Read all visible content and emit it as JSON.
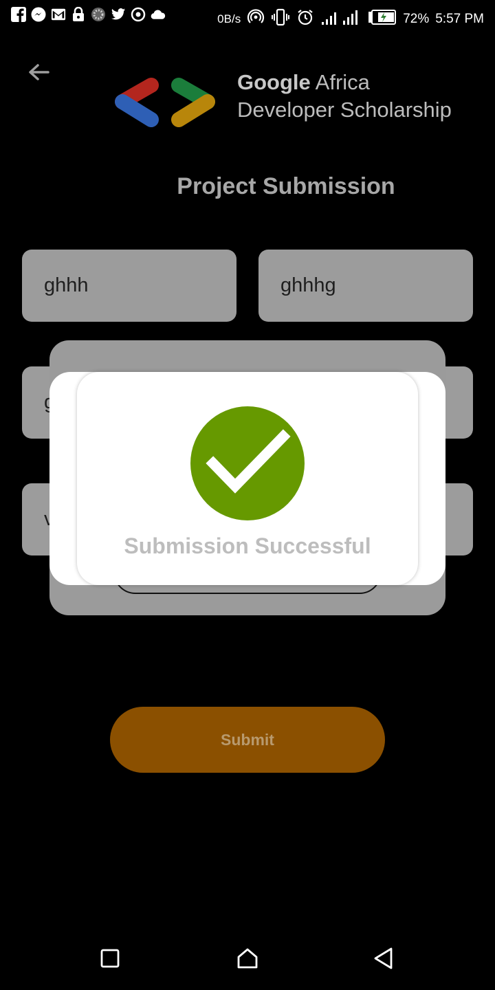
{
  "status_bar": {
    "left_icons": [
      "facebook-icon",
      "messenger-icon",
      "gmail-icon",
      "lock-icon",
      "loading-icon",
      "twitter-icon",
      "target-icon",
      "cloud-icon"
    ],
    "network_speed": "0B/s",
    "battery_percent": "72%",
    "time": "5:57 PM"
  },
  "header": {
    "brand_line1_bold": "Google",
    "brand_line1_rest": " Africa",
    "brand_line2": "Developer Scholarship",
    "logo_colors": [
      "#c62828",
      "#2e7d32",
      "#1565c0",
      "#f9a825"
    ]
  },
  "page_title": "Project Submission",
  "form": {
    "first_name_value": "ghhh",
    "last_name_value": "ghhhg",
    "email_partial": "g",
    "link_partial": "v"
  },
  "dialog": {
    "message": "Submission Successful",
    "check_color": "#669900"
  },
  "submit_button": {
    "label": "Submit",
    "color": "#8b5000"
  },
  "nav": {
    "icons": [
      "recents-square-icon",
      "home-icon",
      "back-triangle-icon"
    ]
  }
}
